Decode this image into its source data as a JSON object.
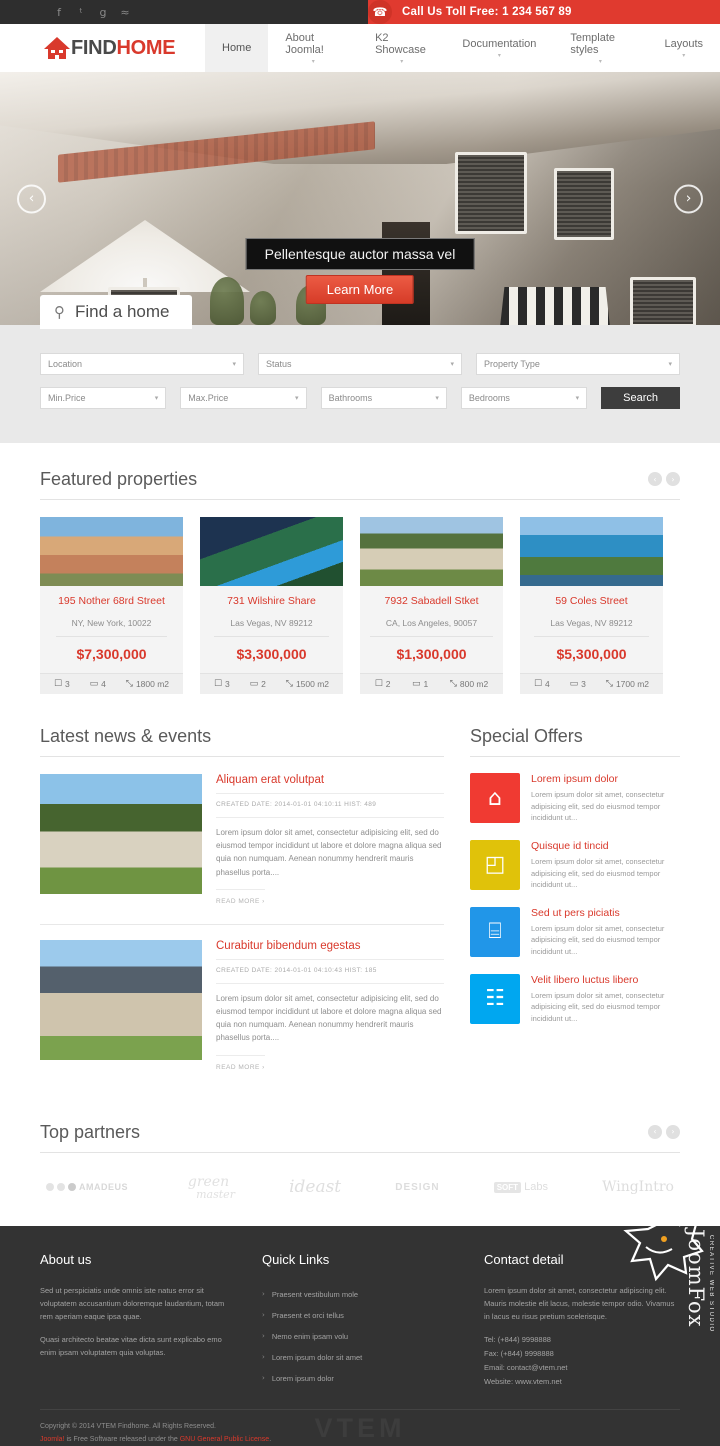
{
  "topbar": {
    "social": [
      {
        "name": "facebook-icon",
        "glyph": "f"
      },
      {
        "name": "twitter-icon",
        "glyph": "ᵗ"
      },
      {
        "name": "googleplus-icon",
        "glyph": "g"
      },
      {
        "name": "rss-icon",
        "glyph": "≈"
      }
    ],
    "phone_icon": "☎",
    "call_text": "Call Us Toll Free: 1 234 567 89",
    "accent": "#e03a2f"
  },
  "header": {
    "logo_find": "FIND",
    "logo_home": "HOME",
    "nav": [
      {
        "label": "Home",
        "caret": false,
        "active": true
      },
      {
        "label": "About Joomla!",
        "caret": true,
        "active": false
      },
      {
        "label": "K2 Showcase",
        "caret": true,
        "active": false
      },
      {
        "label": "Documentation",
        "caret": true,
        "active": false
      },
      {
        "label": "Template styles",
        "caret": true,
        "active": false
      },
      {
        "label": "Layouts",
        "caret": true,
        "active": false
      }
    ]
  },
  "hero": {
    "prev_icon": "‹",
    "next_icon": "›",
    "caption": "Pellentesque auctor massa vel",
    "button": "Learn More"
  },
  "search": {
    "tab_icon": "⚲",
    "tab_label": "Find a home",
    "row1": [
      "Location",
      "Status",
      "Property Type"
    ],
    "row2": [
      "Min.Price",
      "Max.Price",
      "Bathrooms",
      "Bedrooms"
    ],
    "button": "Search",
    "caret": "▾"
  },
  "featured": {
    "title": "Featured properties",
    "prev_icon": "‹",
    "next_icon": "›",
    "icons": {
      "bath": "☐",
      "bed": "▭",
      "area": "⤡"
    },
    "items": [
      {
        "title": "195 Nother 68rd Street",
        "address": "NY, New York, 10022",
        "price": "$7,300,000",
        "bath": "3",
        "bed": "4",
        "area": "1800 m2"
      },
      {
        "title": "731 Wilshire Share",
        "address": "Las Vegas, NV 89212",
        "price": "$3,300,000",
        "bath": "3",
        "bed": "2",
        "area": "1500 m2"
      },
      {
        "title": "7932 Sabadell Stket",
        "address": "CA, Los Angeles, 90057",
        "price": "$1,300,000",
        "bath": "2",
        "bed": "1",
        "area": "800 m2"
      },
      {
        "title": "59 Coles Street",
        "address": "Las Vegas, NV 89212",
        "price": "$5,300,000",
        "bath": "4",
        "bed": "3",
        "area": "1700 m2"
      }
    ]
  },
  "news": {
    "title": "Latest news & events",
    "items": [
      {
        "title": "Aliquam erat volutpat",
        "meta": "CREATED DATE: 2014-01-01 04:10:11    HIST: 489",
        "text": "Lorem ipsum dolor sit amet, consectetur adipisicing elit, sed do eiusmod tempor incididunt ut labore et dolore magna aliqua sed quia non numquam. Aenean nonummy hendrerit mauris phasellus porta....",
        "read_more": "READ MORE  ›"
      },
      {
        "title": "Curabitur bibendum egestas",
        "meta": "CREATED DATE: 2014-01-01 04:10:43    HIST: 185",
        "text": "Lorem ipsum dolor sit amet, consectetur adipisicing elit, sed do eiusmod tempor incididunt ut labore et dolore magna aliqua sed quia non numquam. Aenean nonummy hendrerit mauris phasellus porta....",
        "read_more": "READ MORE  ›"
      }
    ]
  },
  "offers": {
    "title": "Special Offers",
    "items": [
      {
        "title": "Lorem ipsum dolor",
        "text": "Lorem ipsum dolor sit amet, consectetur adipisicing elit, sed do eiusmod tempor incididunt ut...",
        "color": "#f03a32",
        "icon": "⌂",
        "icon_name": "house-pencil-icon"
      },
      {
        "title": "Quisque id tincid",
        "text": "Lorem ipsum dolor sit amet, consectetur adipisicing elit, sed do eiusmod tempor incididunt ut...",
        "color": "#e0c20a",
        "icon": "◰",
        "icon_name": "cards-icon"
      },
      {
        "title": "Sed ut pers piciatis",
        "text": "Lorem ipsum dolor sit amet, consectetur adipisicing elit, sed do eiusmod tempor incididunt ut...",
        "color": "#2196e8",
        "icon": "⌸",
        "icon_name": "calculator-icon"
      },
      {
        "title": "Velit libero luctus libero",
        "text": "Lorem ipsum dolor sit amet, consectetur adipisicing elit, sed do eiusmod tempor incididunt ut...",
        "color": "#00a7f0",
        "icon": "☷",
        "icon_name": "newspaper-icon"
      }
    ]
  },
  "partners": {
    "title": "Top partners",
    "prev_icon": "‹",
    "next_icon": "›",
    "items": [
      "AMADEUS",
      "green master",
      "ideast",
      "DESIGN",
      "SOFT Labs",
      "WingIntro"
    ]
  },
  "footer": {
    "about": {
      "title": "About us",
      "p1": "Sed ut perspiciatis unde omnis iste natus error sit voluptatem accusantium doloremque laudantium, totam rem aperiam eaque ipsa quae.",
      "p2": "Quasi architecto beatae vitae dicta sunt explicabo emo enim ipsam voluptatem quia voluptas."
    },
    "quick": {
      "title": "Quick Links",
      "links": [
        "Praesent vestibulum mole",
        "Praesent et orci tellus",
        "Nemo enim ipsam volu",
        "Lorem ipsum dolor sit amet",
        "Lorem ipsum dolor"
      ],
      "chevron": "›"
    },
    "contact": {
      "title": "Contact detail",
      "text": "Lorem ipsum dolor sit amet, consectetur adipiscing elit. Mauris molestie elit lacus, molestie tempor odio. Vivamus in lacus eu risus pretium scelerisque.",
      "tel": "Tel: (+844) 9998888",
      "fax": "Fax: (+844) 9998888",
      "email": "Email: contact@vtem.net",
      "website": "Website: www.vtem.net"
    },
    "copyright_line1": "Copyright © 2014 VTEM Findhome. All Rights Reserved.",
    "copyright_joomla": "Joomla!",
    "copyright_mid": " is Free Software released under the ",
    "copyright_gpl": "GNU General Public License",
    "copyright_end": ".",
    "watermark": "VTEM",
    "brand": "JoomFox",
    "brand_sub": "CREATIVE WEB STUDIO"
  }
}
